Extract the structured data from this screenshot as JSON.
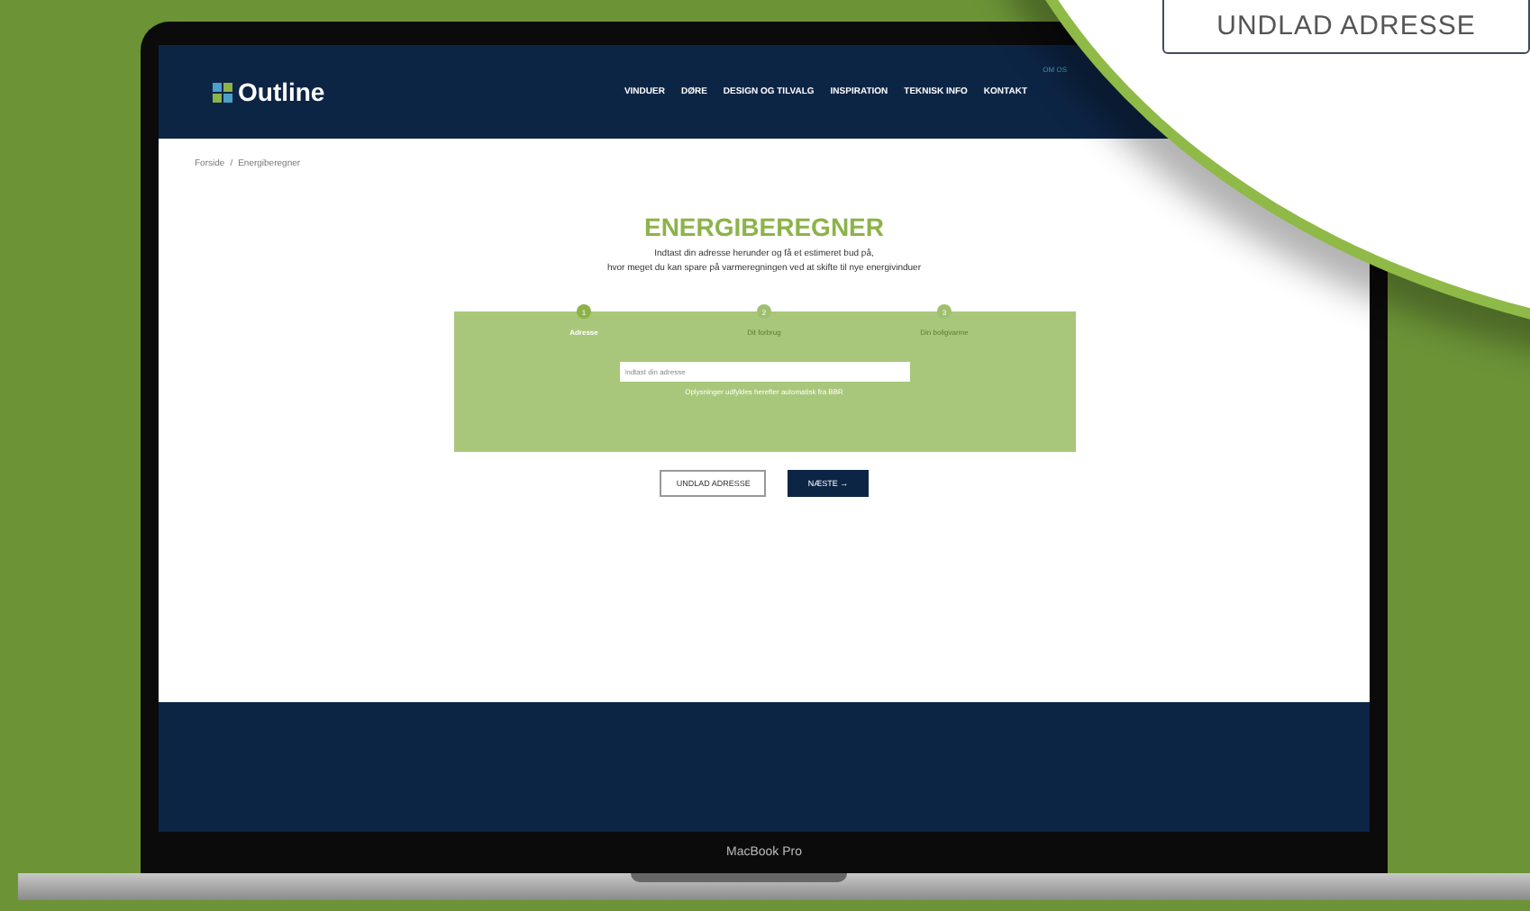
{
  "device_label": "MacBook Pro",
  "nav": {
    "logo": "Outline",
    "top_link": "OM OS",
    "items": [
      {
        "label": "VINDUER"
      },
      {
        "label": "DØRE"
      },
      {
        "label": "DESIGN OG TILVALG"
      },
      {
        "label": "INSPIRATION"
      },
      {
        "label": "TEKNISK INFO"
      },
      {
        "label": "KONTAKT"
      }
    ]
  },
  "breadcrumb": [
    "Forside",
    "/",
    "Energiberegner"
  ],
  "heading": "ENERGIBEREGNER",
  "intro": [
    "Indtast din adresse herunder og få et estimeret bud på,",
    "hvor meget du kan spare på varmeregningen ved at skifte til nye energivinduer"
  ],
  "steps": [
    {
      "number": "1",
      "label": "Adresse",
      "selected": true
    },
    {
      "number": "2",
      "label": "Dit forbrug",
      "selected": false
    },
    {
      "number": "3",
      "label": "Din boligvarme",
      "selected": false
    }
  ],
  "address_field": {
    "placeholder": "Indtast din adresse"
  },
  "helper": "Oplysninger udfyldes herefter automatisk fra BBR",
  "buttons": [
    {
      "kind": "outline",
      "label": "UNDLAD ADRESSE"
    },
    {
      "kind": "primary",
      "label": "NÆSTE",
      "arrow": "→"
    }
  ],
  "callout": {
    "button": "UNDLAD ADRESSE"
  }
}
